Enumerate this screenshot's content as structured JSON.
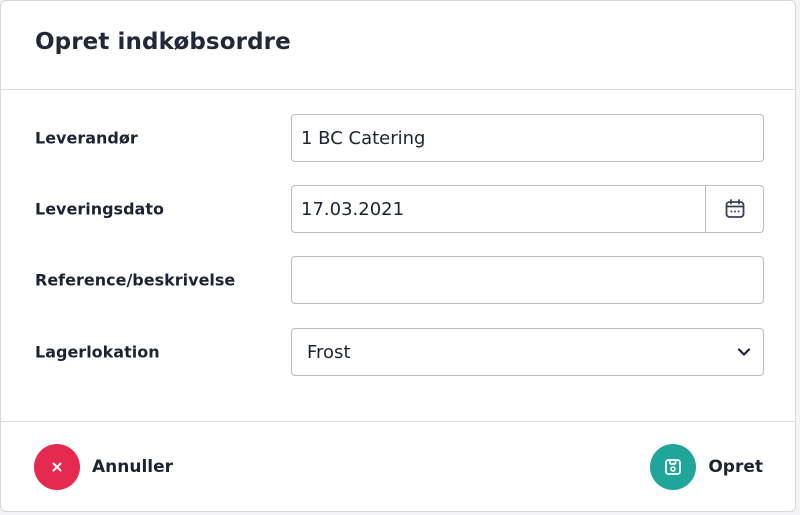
{
  "dialog": {
    "title": "Opret indkøbsordre"
  },
  "form": {
    "supplier": {
      "label": "Leverandør",
      "value": "1 BC Catering"
    },
    "delivery_date": {
      "label": "Leveringsdato",
      "value": "17.03.2021",
      "icon": "calendar-icon"
    },
    "reference": {
      "label": "Reference/beskrivelse",
      "value": ""
    },
    "location": {
      "label": "Lagerlokation",
      "selected": "Frost",
      "icon": "chevron-down-icon"
    }
  },
  "footer": {
    "cancel": {
      "label": "Annuller",
      "icon": "close-icon",
      "color": "#e5294f"
    },
    "create": {
      "label": "Opret",
      "icon": "save-icon",
      "color": "#1fa59a"
    }
  }
}
